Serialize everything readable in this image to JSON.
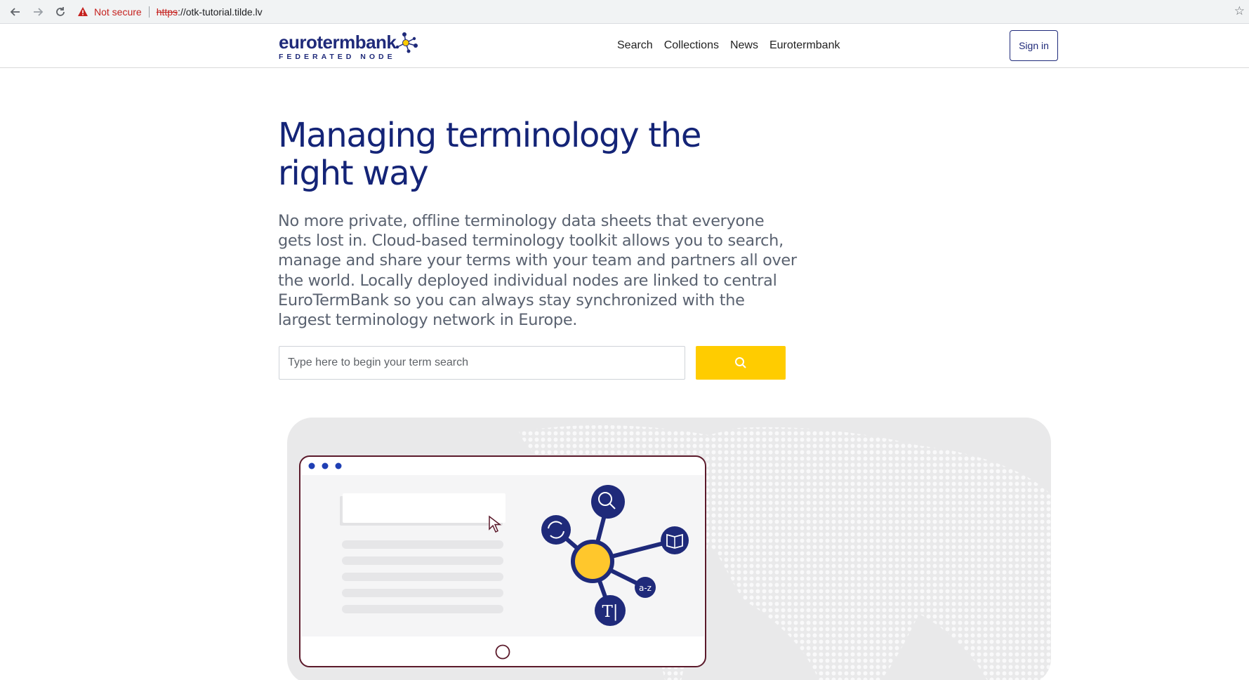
{
  "browser": {
    "security_label": "Not secure",
    "url_protocol": "https",
    "url_rest": "://otk-tutorial.tilde.lv"
  },
  "header": {
    "logo_main": "eurotermbank",
    "logo_sub": "FEDERATED NODE",
    "nav": [
      "Search",
      "Collections",
      "News",
      "Eurotermbank"
    ],
    "signin_label": "Sign in"
  },
  "hero": {
    "title": "Managing terminology the right way",
    "description": "No more private, offline terminology data sheets that everyone gets lost in. Cloud-based terminology toolkit allows you to search, manage and share your terms with your team and partners all over the world. Locally deployed individual nodes are linked to central EuroTermBank so you can always stay synchronized with the largest terminology network in Europe."
  },
  "search": {
    "placeholder": "Type here to begin your term search",
    "value": ""
  },
  "illustration": {
    "az_label": "a-z",
    "t_label": "T|"
  },
  "colors": {
    "brand_navy": "#1f2a7a",
    "accent_yellow": "#ffcc00",
    "warning_red": "#c5221f"
  }
}
